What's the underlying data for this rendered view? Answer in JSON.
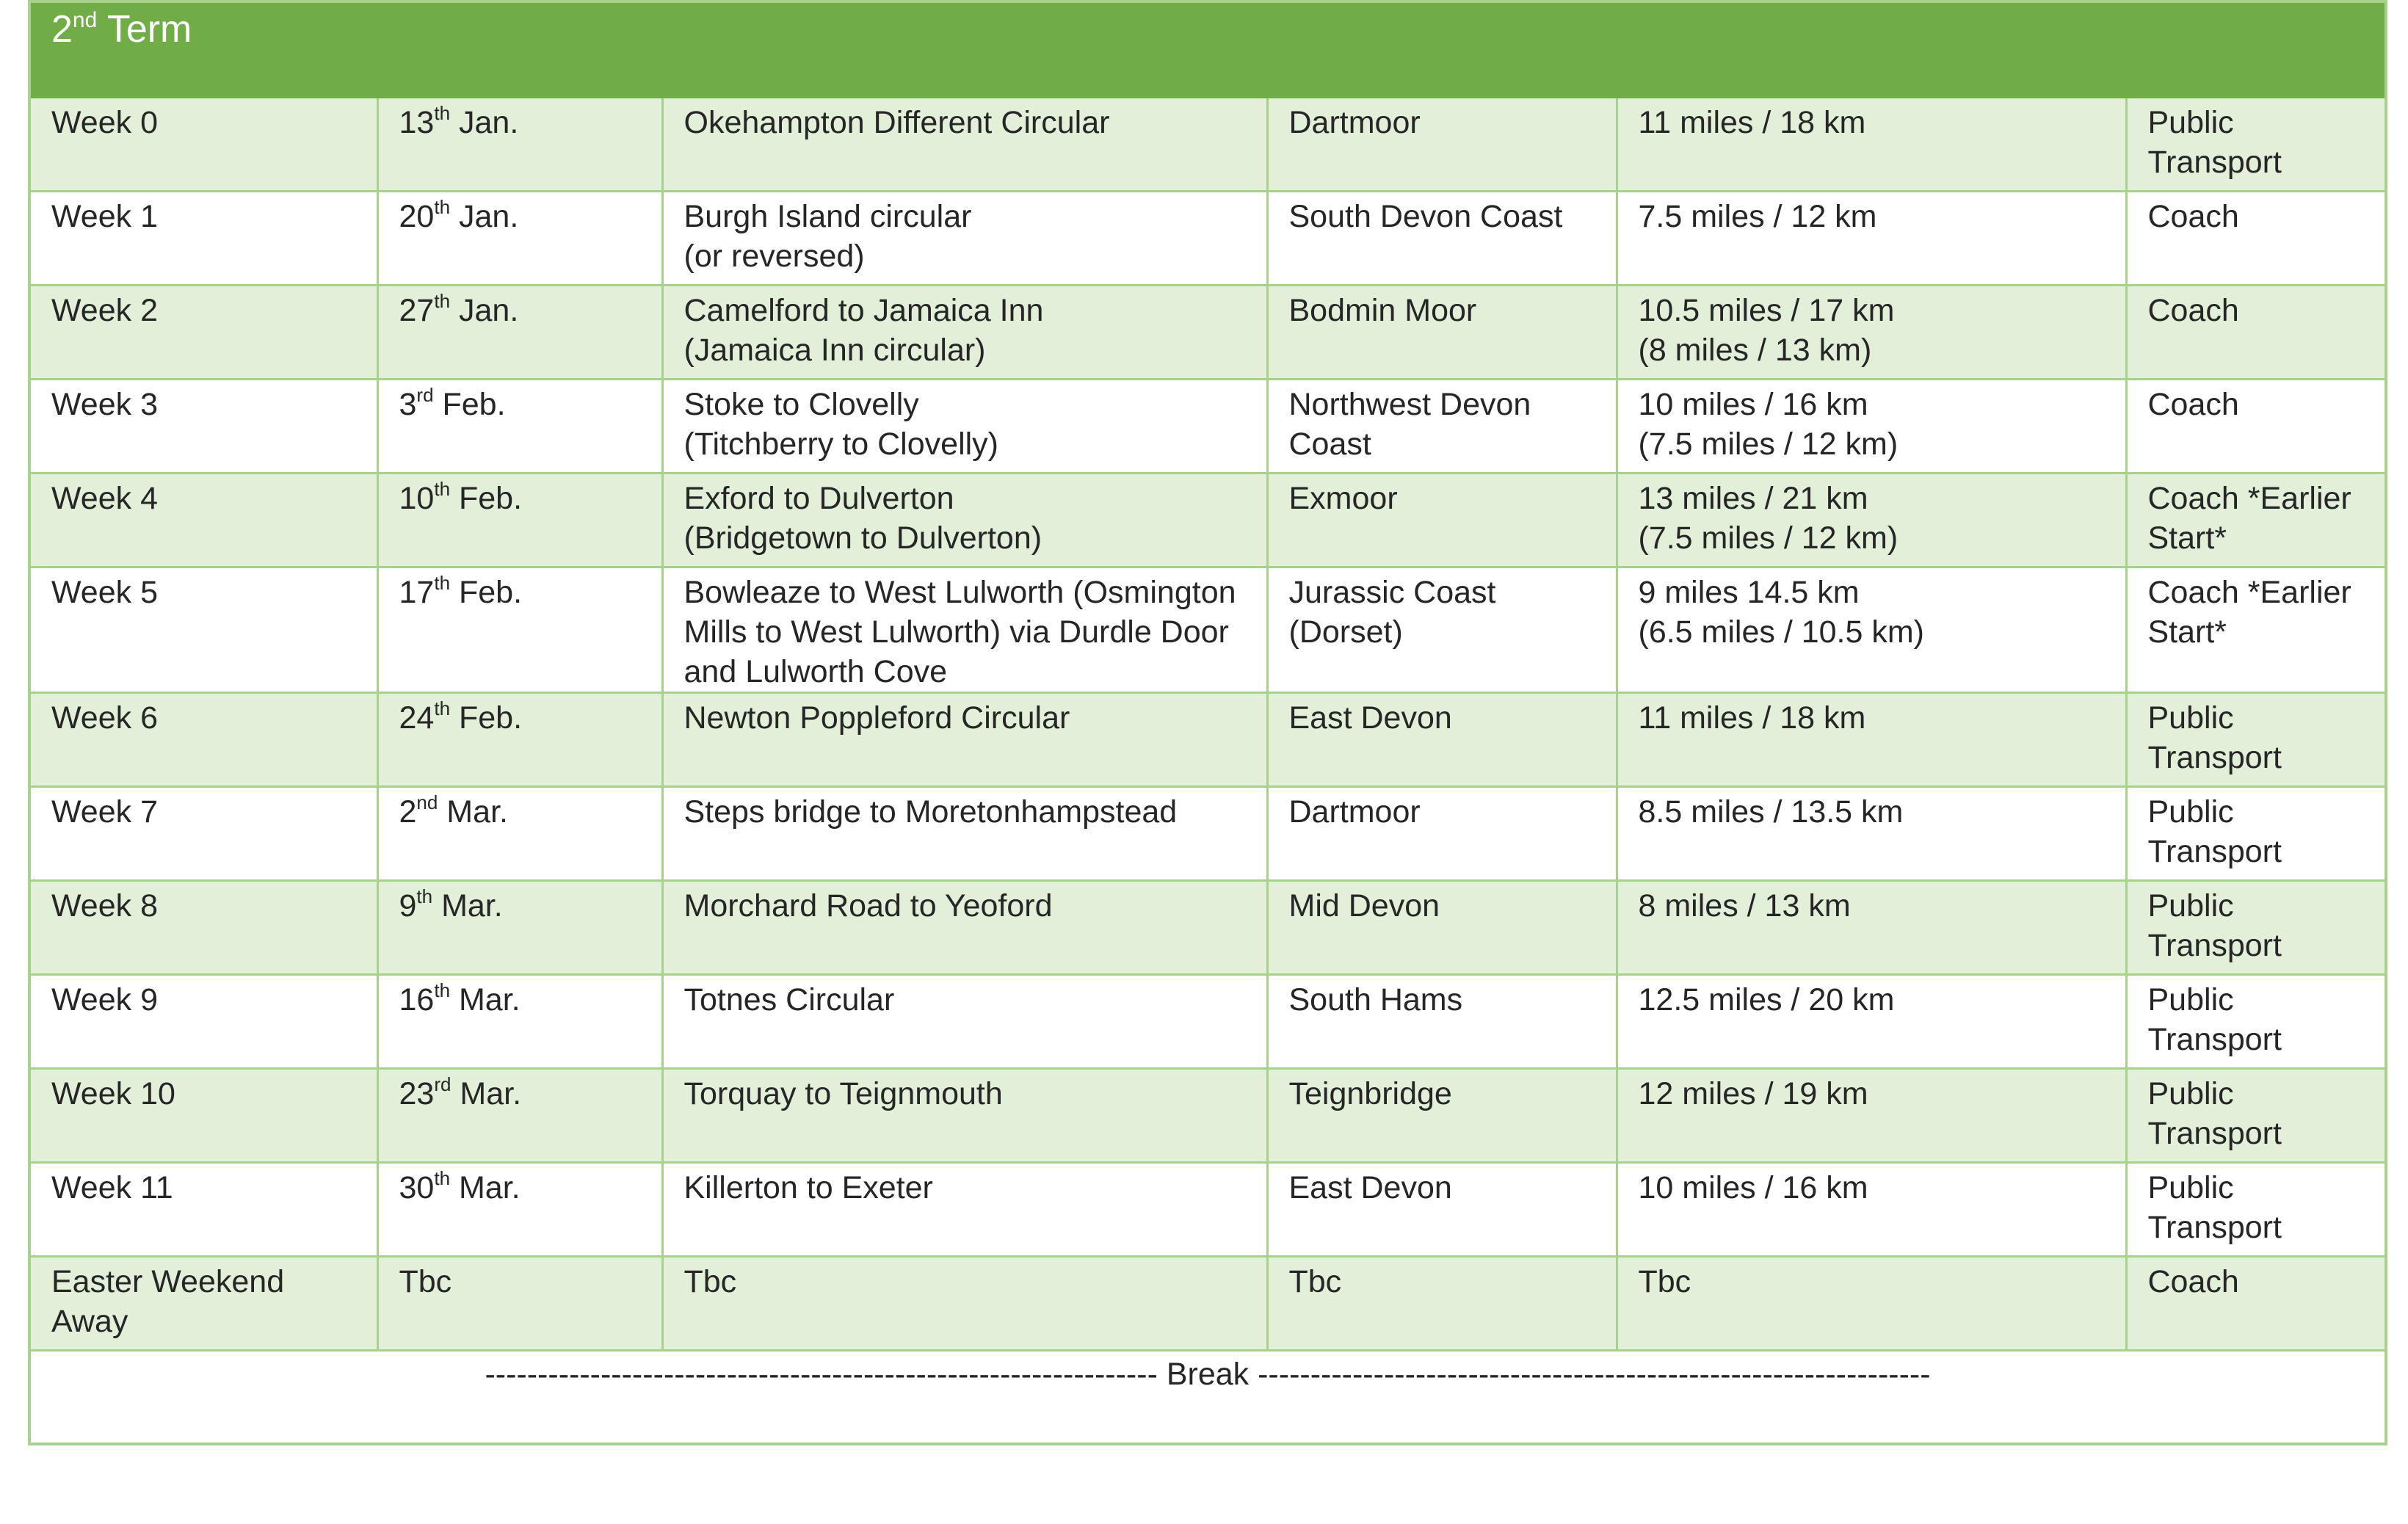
{
  "term": {
    "number": "2",
    "suffix": "nd",
    "label": "Term"
  },
  "rows": [
    {
      "week": "Week 0",
      "date_day": "13",
      "date_suffix": "th",
      "date_month": "Jan.",
      "route": "Okehampton Different Circular",
      "area": "Dartmoor",
      "distance": "11 miles / 18 km",
      "transport": "Public Transport"
    },
    {
      "week": "Week 1",
      "date_day": "20",
      "date_suffix": "th",
      "date_month": "Jan.",
      "route": "Burgh Island circular\n(or reversed)",
      "area": "South Devon Coast",
      "distance": "7.5 miles / 12 km",
      "transport": "Coach"
    },
    {
      "week": "Week 2",
      "date_day": "27",
      "date_suffix": "th",
      "date_month": "Jan.",
      "route": "Camelford to Jamaica Inn\n(Jamaica Inn circular)",
      "area": "Bodmin Moor",
      "distance": "10.5 miles / 17 km\n(8 miles / 13 km)",
      "transport": "Coach"
    },
    {
      "week": "Week 3",
      "date_day": "3",
      "date_suffix": "rd",
      "date_month": "Feb.",
      "route": "Stoke to Clovelly\n(Titchberry to Clovelly)",
      "area": "Northwest Devon\nCoast",
      "distance": "10 miles / 16 km\n(7.5 miles / 12 km)",
      "transport": "Coach"
    },
    {
      "week": "Week 4",
      "date_day": "10",
      "date_suffix": "th",
      "date_month": "Feb.",
      "route": "Exford to Dulverton\n(Bridgetown to Dulverton)",
      "area": "Exmoor",
      "distance": "13 miles / 21 km\n(7.5 miles / 12 km)",
      "transport": "Coach\n*Earlier Start*"
    },
    {
      "week": "Week 5",
      "date_day": "17",
      "date_suffix": "th",
      "date_month": "Feb.",
      "route": "Bowleaze to West Lulworth (Osmington\nMills to West Lulworth) via Durdle Door\nand Lulworth Cove",
      "area": "Jurassic Coast\n(Dorset)",
      "distance": "9 miles 14.5 km\n(6.5 miles / 10.5 km)",
      "transport": "Coach\n*Earlier Start*"
    },
    {
      "week": "Week 6",
      "date_day": "24",
      "date_suffix": "th",
      "date_month": "Feb.",
      "route": "Newton Poppleford Circular",
      "area": "East Devon",
      "distance": "11 miles / 18 km",
      "transport": "Public Transport"
    },
    {
      "week": "Week 7",
      "date_day": "2",
      "date_suffix": "nd",
      "date_month": "Mar.",
      "route": "Steps bridge to Moretonhampstead",
      "area": "Dartmoor",
      "distance": "8.5 miles / 13.5 km",
      "transport": "Public Transport"
    },
    {
      "week": "Week 8",
      "date_day": "9",
      "date_suffix": "th",
      "date_month": "Mar.",
      "route": "Morchard Road to Yeoford",
      "area": "Mid Devon",
      "distance": "8 miles / 13 km",
      "transport": "Public Transport"
    },
    {
      "week": "Week 9",
      "date_day": "16",
      "date_suffix": "th",
      "date_month": "Mar.",
      "route": "Totnes Circular",
      "area": "South Hams",
      "distance": "12.5 miles / 20 km",
      "transport": "Public Transport"
    },
    {
      "week": "Week 10",
      "date_day": "23",
      "date_suffix": "rd",
      "date_month": "Mar.",
      "route": "Torquay to Teignmouth",
      "area": "Teignbridge",
      "distance": "12 miles / 19 km",
      "transport": "Public Transport"
    },
    {
      "week": "Week 11",
      "date_day": "30",
      "date_suffix": "th",
      "date_month": "Mar.",
      "route": "Killerton to Exeter",
      "area": "East Devon",
      "distance": "10 miles / 16 km",
      "transport": "Public Transport"
    },
    {
      "week": "Easter Weekend Away",
      "date_day": "Tbc",
      "date_suffix": "",
      "date_month": "",
      "route": "Tbc",
      "area": "Tbc",
      "distance": "Tbc",
      "transport": "Coach"
    }
  ],
  "break_text": "---------------------------------------------------------------- Break ----------------------------------------------------------------"
}
